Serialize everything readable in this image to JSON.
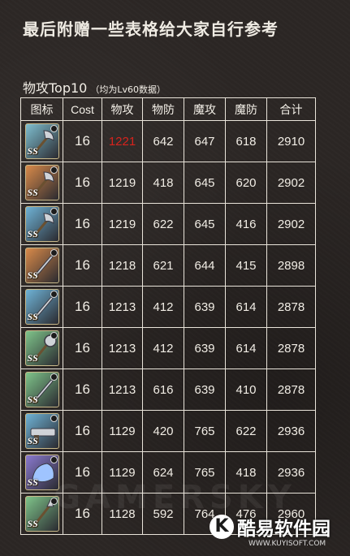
{
  "headline": "最后附赠一些表格给大家自行参考",
  "section": {
    "title": "物攻Top10",
    "subtitle": "（均为Lv60数据）"
  },
  "table": {
    "headers": [
      "图标",
      "Cost",
      "物攻",
      "物防",
      "魔攻",
      "魔防",
      "合计"
    ],
    "rows": [
      {
        "rarity": "SS",
        "cost": "16",
        "patk": "1221",
        "pdef": "642",
        "matk": "647",
        "mdef": "618",
        "total": "2910",
        "icon": "battle-axe-icon",
        "frame": "#7fbfd0",
        "highlight": "#d8231d"
      },
      {
        "rarity": "SS",
        "cost": "16",
        "patk": "1219",
        "pdef": "418",
        "matk": "645",
        "mdef": "620",
        "total": "2902",
        "icon": "battle-axe-icon",
        "frame": "#d98a4a"
      },
      {
        "rarity": "SS",
        "cost": "16",
        "patk": "1219",
        "pdef": "622",
        "matk": "645",
        "mdef": "416",
        "total": "2902",
        "icon": "battle-axe-icon",
        "frame": "#6fb3d6"
      },
      {
        "rarity": "SS",
        "cost": "16",
        "patk": "1218",
        "pdef": "621",
        "matk": "644",
        "mdef": "415",
        "total": "2898",
        "icon": "sword-icon",
        "frame": "#d98a4a"
      },
      {
        "rarity": "SS",
        "cost": "16",
        "patk": "1213",
        "pdef": "412",
        "matk": "639",
        "mdef": "614",
        "total": "2878",
        "icon": "sword-icon",
        "frame": "#6fb3d6"
      },
      {
        "rarity": "SS",
        "cost": "16",
        "patk": "1213",
        "pdef": "412",
        "matk": "639",
        "mdef": "614",
        "total": "2878",
        "icon": "mace-icon",
        "frame": "#7fc48a"
      },
      {
        "rarity": "SS",
        "cost": "16",
        "patk": "1213",
        "pdef": "616",
        "matk": "639",
        "mdef": "410",
        "total": "2878",
        "icon": "sword-icon",
        "frame": "#7fc48a"
      },
      {
        "rarity": "SS",
        "cost": "16",
        "patk": "1129",
        "pdef": "420",
        "matk": "765",
        "mdef": "622",
        "total": "2936",
        "icon": "gun-icon",
        "frame": "#6fb3d6"
      },
      {
        "rarity": "SS",
        "cost": "16",
        "patk": "1129",
        "pdef": "624",
        "matk": "765",
        "mdef": "418",
        "total": "2936",
        "icon": "gauntlet-icon",
        "frame": "#8a7ad0"
      },
      {
        "rarity": "SS",
        "cost": "16",
        "patk": "1128",
        "pdef": "592",
        "matk": "764",
        "mdef": "476",
        "total": "2960",
        "icon": "spear-icon",
        "frame": "#7fc48a"
      }
    ]
  },
  "watermark": "GAMERSKY",
  "logo": {
    "mark": "K",
    "name": "酷易软件园",
    "url": "WWW.KUYISOFT.COM"
  }
}
